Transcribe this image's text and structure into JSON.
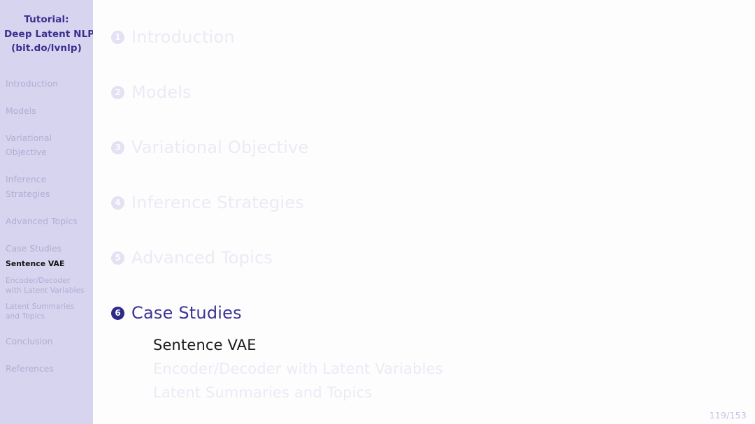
{
  "sidebar": {
    "title_lines": [
      "Tutorial:",
      "Deep Latent NLP",
      "(bit.do/lvnlp)"
    ],
    "sections": [
      {
        "label": "Introduction"
      },
      {
        "label": "Models"
      },
      {
        "label": "Variational Objective"
      },
      {
        "label": "Inference Strategies"
      },
      {
        "label": "Advanced Topics"
      },
      {
        "label": "Case Studies"
      },
      {
        "label": "Conclusion"
      },
      {
        "label": "References"
      }
    ],
    "subsections": [
      {
        "label": "Sentence VAE",
        "active": true
      },
      {
        "label": "Encoder/Decoder with Latent Variables",
        "active": false
      },
      {
        "label": "Latent Summaries and Topics",
        "active": false
      }
    ],
    "colors": {
      "background": "#d6d4ef",
      "title": "#3b2f8f",
      "inactive": "#b0aed2",
      "active": "#111111"
    }
  },
  "main": {
    "toc": [
      {
        "number": "1",
        "label": "Introduction",
        "active": false
      },
      {
        "number": "2",
        "label": "Models",
        "active": false
      },
      {
        "number": "3",
        "label": "Variational Objective",
        "active": false
      },
      {
        "number": "4",
        "label": "Inference Strategies",
        "active": false
      },
      {
        "number": "5",
        "label": "Advanced Topics",
        "active": false
      },
      {
        "number": "6",
        "label": "Case Studies",
        "active": true
      }
    ],
    "subsections": [
      {
        "label": "Sentence VAE",
        "active": true
      },
      {
        "label": "Encoder/Decoder with Latent Variables",
        "active": false
      },
      {
        "label": "Latent Summaries and Topics",
        "active": false
      }
    ],
    "colors": {
      "background": "#fdfdfd",
      "active_section": "#3b3597",
      "active_badge": "#2e2a86",
      "dim_text": "#eceaf6",
      "active_subsection": "#1a1a1a"
    }
  },
  "footer": {
    "page_number": "119/153",
    "color": "#c5c3e2"
  }
}
